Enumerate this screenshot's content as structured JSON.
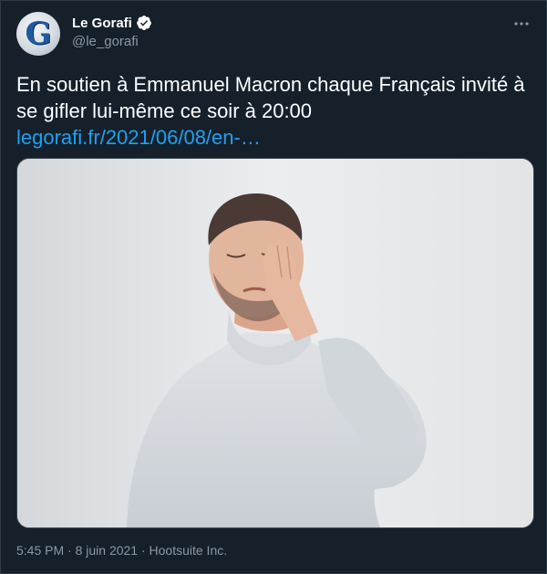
{
  "author": {
    "display_name": "Le Gorafi",
    "handle": "@le_gorafi",
    "avatar_letter": "G",
    "verified": true
  },
  "tweet": {
    "text": "En soutien à Emmanuel Macron chaque Français invité à se gifler lui-même ce soir à 20:00",
    "link": "legorafi.fr/2021/06/08/en-…"
  },
  "meta": {
    "time": "5:45 PM",
    "separator": "·",
    "date": "8 juin 2021",
    "source": "Hootsuite Inc.",
    "line": "5:45 PM · 8 juin 2021 · Hootsuite Inc."
  },
  "colors": {
    "background": "#15202b",
    "text": "#ffffff",
    "secondary": "#8899a6",
    "link": "#1da1f2"
  },
  "icons": {
    "verified": "verified-badge-icon",
    "more": "more-options-icon"
  }
}
